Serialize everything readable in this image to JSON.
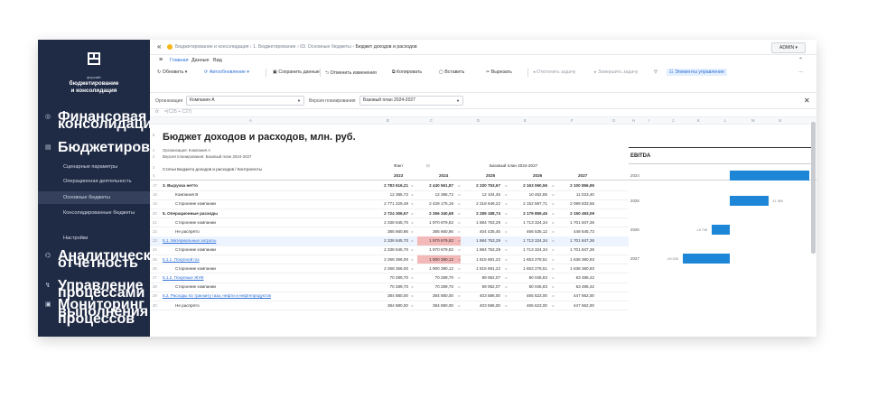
{
  "sidebar": {
    "brand_small": "форсайт",
    "brand": "бюджетирование\nи консолидация",
    "sections": [
      {
        "label": "Финансовая консолидация",
        "icon": "coins-icon"
      },
      {
        "label": "Бюджетирование",
        "icon": "document-icon"
      },
      {
        "label": "Аналитическая отчетность",
        "icon": "analytics-icon"
      },
      {
        "label": "Управление процессами",
        "icon": "process-icon"
      },
      {
        "label": "Мониторинг выполнения процессов",
        "icon": "monitor-icon"
      }
    ],
    "items": [
      {
        "label": "Сценарные параметры"
      },
      {
        "label": "Операционная деятельность"
      },
      {
        "label": "Основные бюджеты"
      },
      {
        "label": "Консолидированные бюджеты"
      },
      {
        "label": "Настройки"
      }
    ]
  },
  "breadcrumb": {
    "path": "Бюджетирование и консолидация › 1. Бюджетирование › 03. Основные бюджеты › ",
    "current": "Бюджет доходов и расходов",
    "user": "ADMIN ▾"
  },
  "menu": {
    "items": [
      "Главная",
      "Данные",
      "Вид"
    ]
  },
  "toolbar": {
    "refresh": "Обновить",
    "auto": "Автообновление",
    "save": "Сохранить данные",
    "undo": "Отменить изменения",
    "copy": "Копировать",
    "paste": "Вставить",
    "cut": "Вырезать",
    "reject": "Отклонить задачу",
    "finish": "Завершить задачу",
    "controls": "Элементы управления",
    "more": "···"
  },
  "filters": {
    "org_label": "Организация",
    "org_value": "Компания А",
    "version_label": "Версия планирования",
    "version_value": "Базовый план 2024-2027"
  },
  "formula": {
    "fx": "fx",
    "value": "=(C25 + C27)"
  },
  "columns": [
    "A",
    "B",
    "C",
    "D",
    "E",
    "F",
    "G",
    "H",
    "I",
    "J",
    "K",
    "L",
    "M",
    "N"
  ],
  "sheet": {
    "title": "Бюджет доходов и расходов, млн. руб.",
    "org_line": "Организация: Компания А",
    "version_line": "Версия планирования: Базовый план 2024-2027",
    "header_label": "Статьи Бюджета доходов и расходов / Контрагенты",
    "fact": "Факт",
    "plan": "Базовый план 2024-2027",
    "years": [
      "2023",
      "2024",
      "2025",
      "2026",
      "2027"
    ],
    "rows": [
      {
        "n": "17",
        "label": "3. Выручка нетто",
        "style": "bold",
        "v": [
          "2 783 616,21",
          "2 440 561,87",
          "2 330 753,67",
          "2 163 060,56",
          "2 100 856,95"
        ]
      },
      {
        "n": "18",
        "label": "Компания В",
        "style": "sub",
        "v": [
          "12 385,72",
          "12 385,72",
          "12 104,45",
          "10 462,85",
          "11 023,40"
        ]
      },
      {
        "n": "19",
        "label": "Сторонние компании",
        "style": "sub",
        "v": [
          "2 771 229,49",
          "2 428 175,16",
          "2 318 649,22",
          "2 152 597,71",
          "2 089 833,56"
        ]
      },
      {
        "n": "20",
        "label": "5. Операционные расходы",
        "style": "bold",
        "v": [
          "2 724 306,57",
          "2 356 340,68",
          "2 289 188,74",
          "2 179 859,45",
          "2 150 493,09"
        ]
      },
      {
        "n": "21",
        "label": "Сторонние компании",
        "style": "sub",
        "v": [
          "2 338 645,70",
          "1 970 679,82",
          "1 884 753,29",
          "1 713 324,34",
          "1 701 847,36"
        ]
      },
      {
        "n": "22",
        "label": "Не распрято",
        "style": "sub",
        "v": [
          "385 660,86",
          "385 660,86",
          "404 435,45",
          "466 535,12",
          "448 645,73"
        ]
      },
      {
        "n": "23",
        "label": "5.1. Материальные затраты",
        "style": "link",
        "v": [
          "2 338 645,70",
          "1 970 679,82",
          "1 884 753,29",
          "1 713 324,34",
          "1 701 847,36"
        ],
        "hl": true
      },
      {
        "n": "24",
        "label": "Сторонние компании",
        "style": "sub",
        "v": [
          "2 338 645,70",
          "1 970 679,82",
          "1 884 753,29",
          "1 713 324,34",
          "1 701 847,36"
        ]
      },
      {
        "n": "25",
        "label": "5.1.1. Покупной газ",
        "style": "link",
        "v": [
          "2 268 356,00",
          "1 900 390,12",
          "1 815 691,22",
          "1 653 278,51",
          "1 638 360,93"
        ],
        "hl": true
      },
      {
        "n": "26",
        "label": "Сторонние компании",
        "style": "sub",
        "v": [
          "2 268 356,00",
          "1 900 390,12",
          "1 815 691,22",
          "1 653 278,51",
          "1 638 360,93"
        ]
      },
      {
        "n": "27",
        "label": "5.1.2. Покупные ЖУВ",
        "style": "link",
        "v": [
          "70 289,70",
          "70 289,70",
          "69 062,07",
          "60 045,83",
          "63 486,42"
        ]
      },
      {
        "n": "28",
        "label": "Сторонние компании",
        "style": "sub",
        "v": [
          "70 289,70",
          "70 289,70",
          "69 062,07",
          "60 045,83",
          "63 486,42"
        ]
      },
      {
        "n": "29",
        "label": "5.2. Расходы по транзиту газа, нефти и нефтепродуктов",
        "style": "link",
        "v": [
          "384 880,00",
          "384 880,00",
          "403 586,00",
          "465 623,00",
          "447 662,00"
        ]
      },
      {
        "n": "30",
        "label": "Не распрято",
        "style": "sub",
        "v": [
          "384 880,00",
          "384 880,00",
          "403 586,00",
          "465 623,00",
          "447 662,00"
        ]
      }
    ]
  },
  "chart_data": {
    "type": "bar",
    "title": "EBITDA",
    "categories": [
      "2024",
      "2025",
      "2026",
      "2027"
    ],
    "values": [
      84221.19,
      41565,
      -18798,
      -49636
    ],
    "data_labels": [
      "",
      "41 565",
      "-18 798",
      "-49 636"
    ]
  }
}
